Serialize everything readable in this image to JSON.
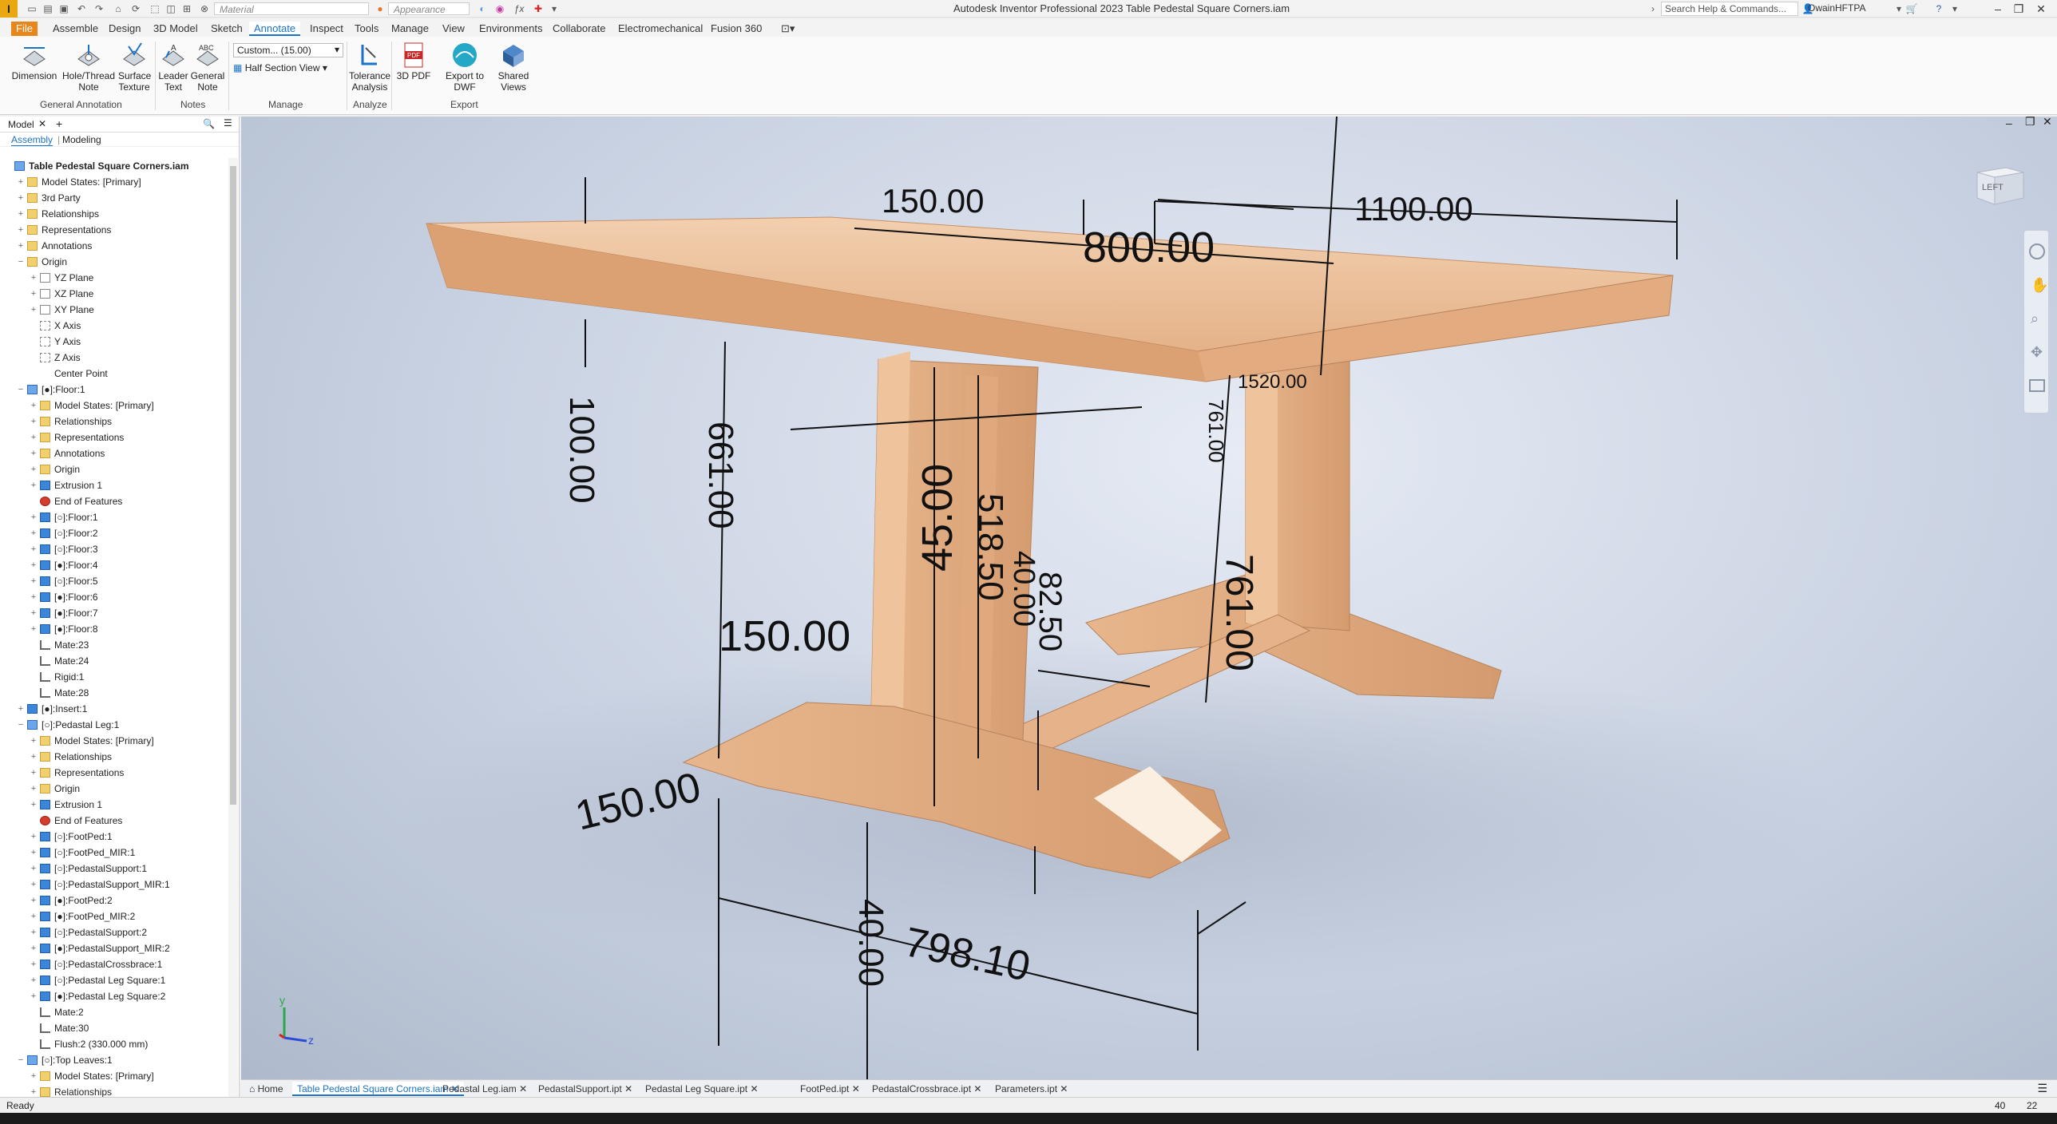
{
  "window": {
    "app_logo": "I",
    "title": "Autodesk Inventor Professional 2023   Table Pedestal Square Corners.iam",
    "material_combo": "Material",
    "appearance_combo": "Appearance",
    "search_placeholder": "Search Help & Commands...",
    "user": "OwainHFTPA"
  },
  "ribbon_tabs": [
    "File",
    "Assemble",
    "Design",
    "3D Model",
    "Sketch",
    "Annotate",
    "Inspect",
    "Tools",
    "Manage",
    "View",
    "Environments",
    "Collaborate",
    "Electromechanical",
    "Fusion 360"
  ],
  "active_tab": "Annotate",
  "ribbon": {
    "dimension": "Dimension",
    "hole_thread_note": [
      "Hole/Thread",
      "Note"
    ],
    "surface_texture": [
      "Surface",
      "Texture"
    ],
    "leader_text": [
      "Leader",
      "Text"
    ],
    "general_note": [
      "General",
      "Note"
    ],
    "style_combo": "Custom... (15.00)",
    "half_section": "Half Section View",
    "tolerance_analysis": [
      "Tolerance",
      "Analysis"
    ],
    "pdf_3d": "3D PDF",
    "export_dwf": "Export to DWF",
    "shared_views": [
      "Shared",
      "Views"
    ],
    "groups": {
      "general_annotation": "General Annotation",
      "notes": "Notes",
      "manage": "Manage",
      "analyze": "Analyze",
      "export": "Export"
    }
  },
  "browser": {
    "tab": "Model",
    "sub_tabs": [
      "Assembly",
      "Modeling"
    ],
    "tree": [
      {
        "label": "Table Pedestal Square Corners.iam",
        "level": 0,
        "icon": "asm",
        "exp": "",
        "bold": true
      },
      {
        "label": "Model States: [Primary]",
        "level": 1,
        "icon": "folder",
        "exp": "+"
      },
      {
        "label": "3rd Party",
        "level": 1,
        "icon": "folder",
        "exp": "+"
      },
      {
        "label": "Relationships",
        "level": 1,
        "icon": "folder",
        "exp": "+"
      },
      {
        "label": "Representations",
        "level": 1,
        "icon": "folder",
        "exp": "+"
      },
      {
        "label": "Annotations",
        "level": 1,
        "icon": "folder",
        "exp": "+"
      },
      {
        "label": "Origin",
        "level": 1,
        "icon": "folder",
        "exp": "−"
      },
      {
        "label": "YZ Plane",
        "level": 2,
        "icon": "plane",
        "exp": "+"
      },
      {
        "label": "XZ Plane",
        "level": 2,
        "icon": "plane",
        "exp": "+"
      },
      {
        "label": "XY Plane",
        "level": 2,
        "icon": "plane",
        "exp": "+"
      },
      {
        "label": "X Axis",
        "level": 2,
        "icon": "axis",
        "exp": ""
      },
      {
        "label": "Y Axis",
        "level": 2,
        "icon": "axis",
        "exp": ""
      },
      {
        "label": "Z Axis",
        "level": 2,
        "icon": "axis",
        "exp": ""
      },
      {
        "label": "Center Point",
        "level": 2,
        "icon": "point",
        "exp": ""
      },
      {
        "label": "[●]:Floor:1",
        "level": 1,
        "icon": "asm",
        "exp": "−"
      },
      {
        "label": "Model States: [Primary]",
        "level": 2,
        "icon": "folder",
        "exp": "+"
      },
      {
        "label": "Relationships",
        "level": 2,
        "icon": "folder",
        "exp": "+"
      },
      {
        "label": "Representations",
        "level": 2,
        "icon": "folder",
        "exp": "+"
      },
      {
        "label": "Annotations",
        "level": 2,
        "icon": "folder",
        "exp": "+"
      },
      {
        "label": "Origin",
        "level": 2,
        "icon": "folder",
        "exp": "+"
      },
      {
        "label": "Extrusion 1",
        "level": 2,
        "icon": "part",
        "exp": "+"
      },
      {
        "label": "End of Features",
        "level": 2,
        "icon": "err",
        "exp": ""
      },
      {
        "label": "[○]:Floor:1",
        "level": 2,
        "icon": "part",
        "exp": "+"
      },
      {
        "label": "[○]:Floor:2",
        "level": 2,
        "icon": "part",
        "exp": "+"
      },
      {
        "label": "[○]:Floor:3",
        "level": 2,
        "icon": "part",
        "exp": "+"
      },
      {
        "label": "[●]:Floor:4",
        "level": 2,
        "icon": "part",
        "exp": "+"
      },
      {
        "label": "[○]:Floor:5",
        "level": 2,
        "icon": "part",
        "exp": "+"
      },
      {
        "label": "[●]:Floor:6",
        "level": 2,
        "icon": "part",
        "exp": "+"
      },
      {
        "label": "[●]:Floor:7",
        "level": 2,
        "icon": "part",
        "exp": "+"
      },
      {
        "label": "[●]:Floor:8",
        "level": 2,
        "icon": "part",
        "exp": "+"
      },
      {
        "label": "Mate:23",
        "level": 2,
        "icon": "mate",
        "exp": ""
      },
      {
        "label": "Mate:24",
        "level": 2,
        "icon": "mate",
        "exp": ""
      },
      {
        "label": "Rigid:1",
        "level": 2,
        "icon": "mate",
        "exp": ""
      },
      {
        "label": "Mate:28",
        "level": 2,
        "icon": "mate",
        "exp": ""
      },
      {
        "label": "[●]:Insert:1",
        "level": 1,
        "icon": "part",
        "exp": "+"
      },
      {
        "label": "[○]:Pedastal Leg:1",
        "level": 1,
        "icon": "asm",
        "exp": "−"
      },
      {
        "label": "Model States: [Primary]",
        "level": 2,
        "icon": "folder",
        "exp": "+"
      },
      {
        "label": "Relationships",
        "level": 2,
        "icon": "folder",
        "exp": "+"
      },
      {
        "label": "Representations",
        "level": 2,
        "icon": "folder",
        "exp": "+"
      },
      {
        "label": "Origin",
        "level": 2,
        "icon": "folder",
        "exp": "+"
      },
      {
        "label": "Extrusion 1",
        "level": 2,
        "icon": "part",
        "exp": "+"
      },
      {
        "label": "End of Features",
        "level": 2,
        "icon": "err",
        "exp": ""
      },
      {
        "label": "[○]:FootPed:1",
        "level": 2,
        "icon": "part",
        "exp": "+"
      },
      {
        "label": "[○]:FootPed_MIR:1",
        "level": 2,
        "icon": "part",
        "exp": "+"
      },
      {
        "label": "[○]:PedastalSupport:1",
        "level": 2,
        "icon": "part",
        "exp": "+"
      },
      {
        "label": "[○]:PedastalSupport_MIR:1",
        "level": 2,
        "icon": "part",
        "exp": "+"
      },
      {
        "label": "[●]:FootPed:2",
        "level": 2,
        "icon": "part",
        "exp": "+"
      },
      {
        "label": "[●]:FootPed_MIR:2",
        "level": 2,
        "icon": "part",
        "exp": "+"
      },
      {
        "label": "[○]:PedastalSupport:2",
        "level": 2,
        "icon": "part",
        "exp": "+"
      },
      {
        "label": "[●]:PedastalSupport_MIR:2",
        "level": 2,
        "icon": "part",
        "exp": "+"
      },
      {
        "label": "[○]:PedastalCrossbrace:1",
        "level": 2,
        "icon": "part",
        "exp": "+"
      },
      {
        "label": "[○]:Pedastal Leg Square:1",
        "level": 2,
        "icon": "part",
        "exp": "+"
      },
      {
        "label": "[●]:Pedastal Leg Square:2",
        "level": 2,
        "icon": "part",
        "exp": "+"
      },
      {
        "label": "Mate:2",
        "level": 2,
        "icon": "mate",
        "exp": ""
      },
      {
        "label": "Mate:30",
        "level": 2,
        "icon": "mate",
        "exp": ""
      },
      {
        "label": "Flush:2 (330.000 mm)",
        "level": 2,
        "icon": "mate",
        "exp": ""
      },
      {
        "label": "[○]:Top Leaves:1",
        "level": 1,
        "icon": "asm",
        "exp": "−"
      },
      {
        "label": "Model States: [Primary]",
        "level": 2,
        "icon": "folder",
        "exp": "+"
      },
      {
        "label": "Relationships",
        "level": 2,
        "icon": "folder",
        "exp": "+"
      }
    ]
  },
  "viewport": {
    "viewcube_face": "LEFT",
    "dimensions": {
      "top_width": "150.00",
      "top_length": "800.00",
      "total_length": "1100.00",
      "left_height": "100.00",
      "leg_height": "661.00",
      "leg_width": "45.00",
      "inner_height": "518.50",
      "brace_height": "40.00",
      "brace_offset": "82.50",
      "foot_width": "150.00",
      "foot_depth": "150.00",
      "foot_height": "40.00",
      "base_length": "798.10",
      "right_height": "761.00",
      "right_height_small": "761.00",
      "top_partial": "1520.00"
    },
    "axis_labels": {
      "y": "y",
      "z": "z"
    }
  },
  "doc_tabs": [
    "Home",
    "Table Pedestal Square Corners.iam",
    "Pedastal Leg.iam",
    "PedastalSupport.ipt",
    "Pedastal Leg Square.ipt",
    "FootPed.ipt",
    "PedastalCrossbrace.ipt",
    "Parameters.ipt"
  ],
  "active_doc": "Table Pedestal Square Corners.iam",
  "status": {
    "text": "Ready",
    "count1": "40",
    "count2": "22"
  },
  "colors": {
    "accent": "#1a73c8",
    "wood": "#e8b891",
    "file_tab": "#e8861c"
  }
}
